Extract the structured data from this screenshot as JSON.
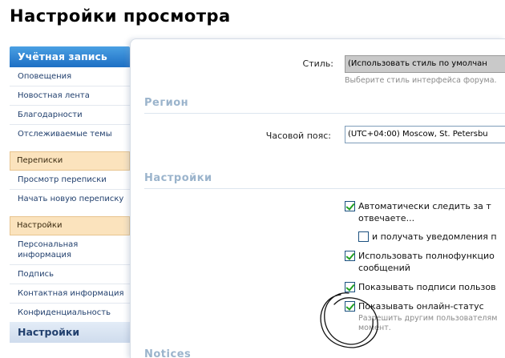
{
  "page": {
    "title": "Настройки просмотра"
  },
  "sidebar": {
    "account_header": "Учётная запись",
    "account_items": [
      "Оповещения",
      "Новостная лента",
      "Благодарности",
      "Отслеживаемые темы"
    ],
    "messages_header": "Переписки",
    "messages_items": [
      "Просмотр переписки",
      "Начать новую переписку"
    ],
    "settings_header": "Настройки",
    "settings_items": [
      "Персональная информация",
      "Подпись",
      "Контактная информация",
      "Конфиденциальность"
    ],
    "bottom_header": "Настройки"
  },
  "form": {
    "style_label": "Стиль:",
    "style_value": "(Использовать стиль по умолчан",
    "style_hint": "Выберите стиль интерфейса форума.",
    "region_title": "Регион",
    "timezone_label": "Часовой пояс:",
    "timezone_value": "(UTC+04:00) Moscow, St. Petersbu",
    "settings_title": "Настройки",
    "options": [
      {
        "line1": "Автоматически следить за т",
        "line2": "отвечаете...",
        "checked": true
      },
      {
        "line1": "и получать уведомления п",
        "line2": "",
        "checked": false
      },
      {
        "line1": "Использовать полнофункцио",
        "line2": "сообщений",
        "checked": true
      },
      {
        "line1": "Показывать подписи пользов",
        "line2": "",
        "checked": true
      },
      {
        "line1": "Показывать онлайн-статус",
        "line2": "",
        "checked": true
      }
    ],
    "online_hint_line1": "Разрешить другим пользователям",
    "online_hint_line2": "момент.",
    "next_section_title": "Notices"
  },
  "colors": {
    "sidebar_header": "#1d6fc4",
    "orange_header": "#fbe3bd",
    "section_title": "#9bb4cc",
    "link": "#22406e"
  }
}
